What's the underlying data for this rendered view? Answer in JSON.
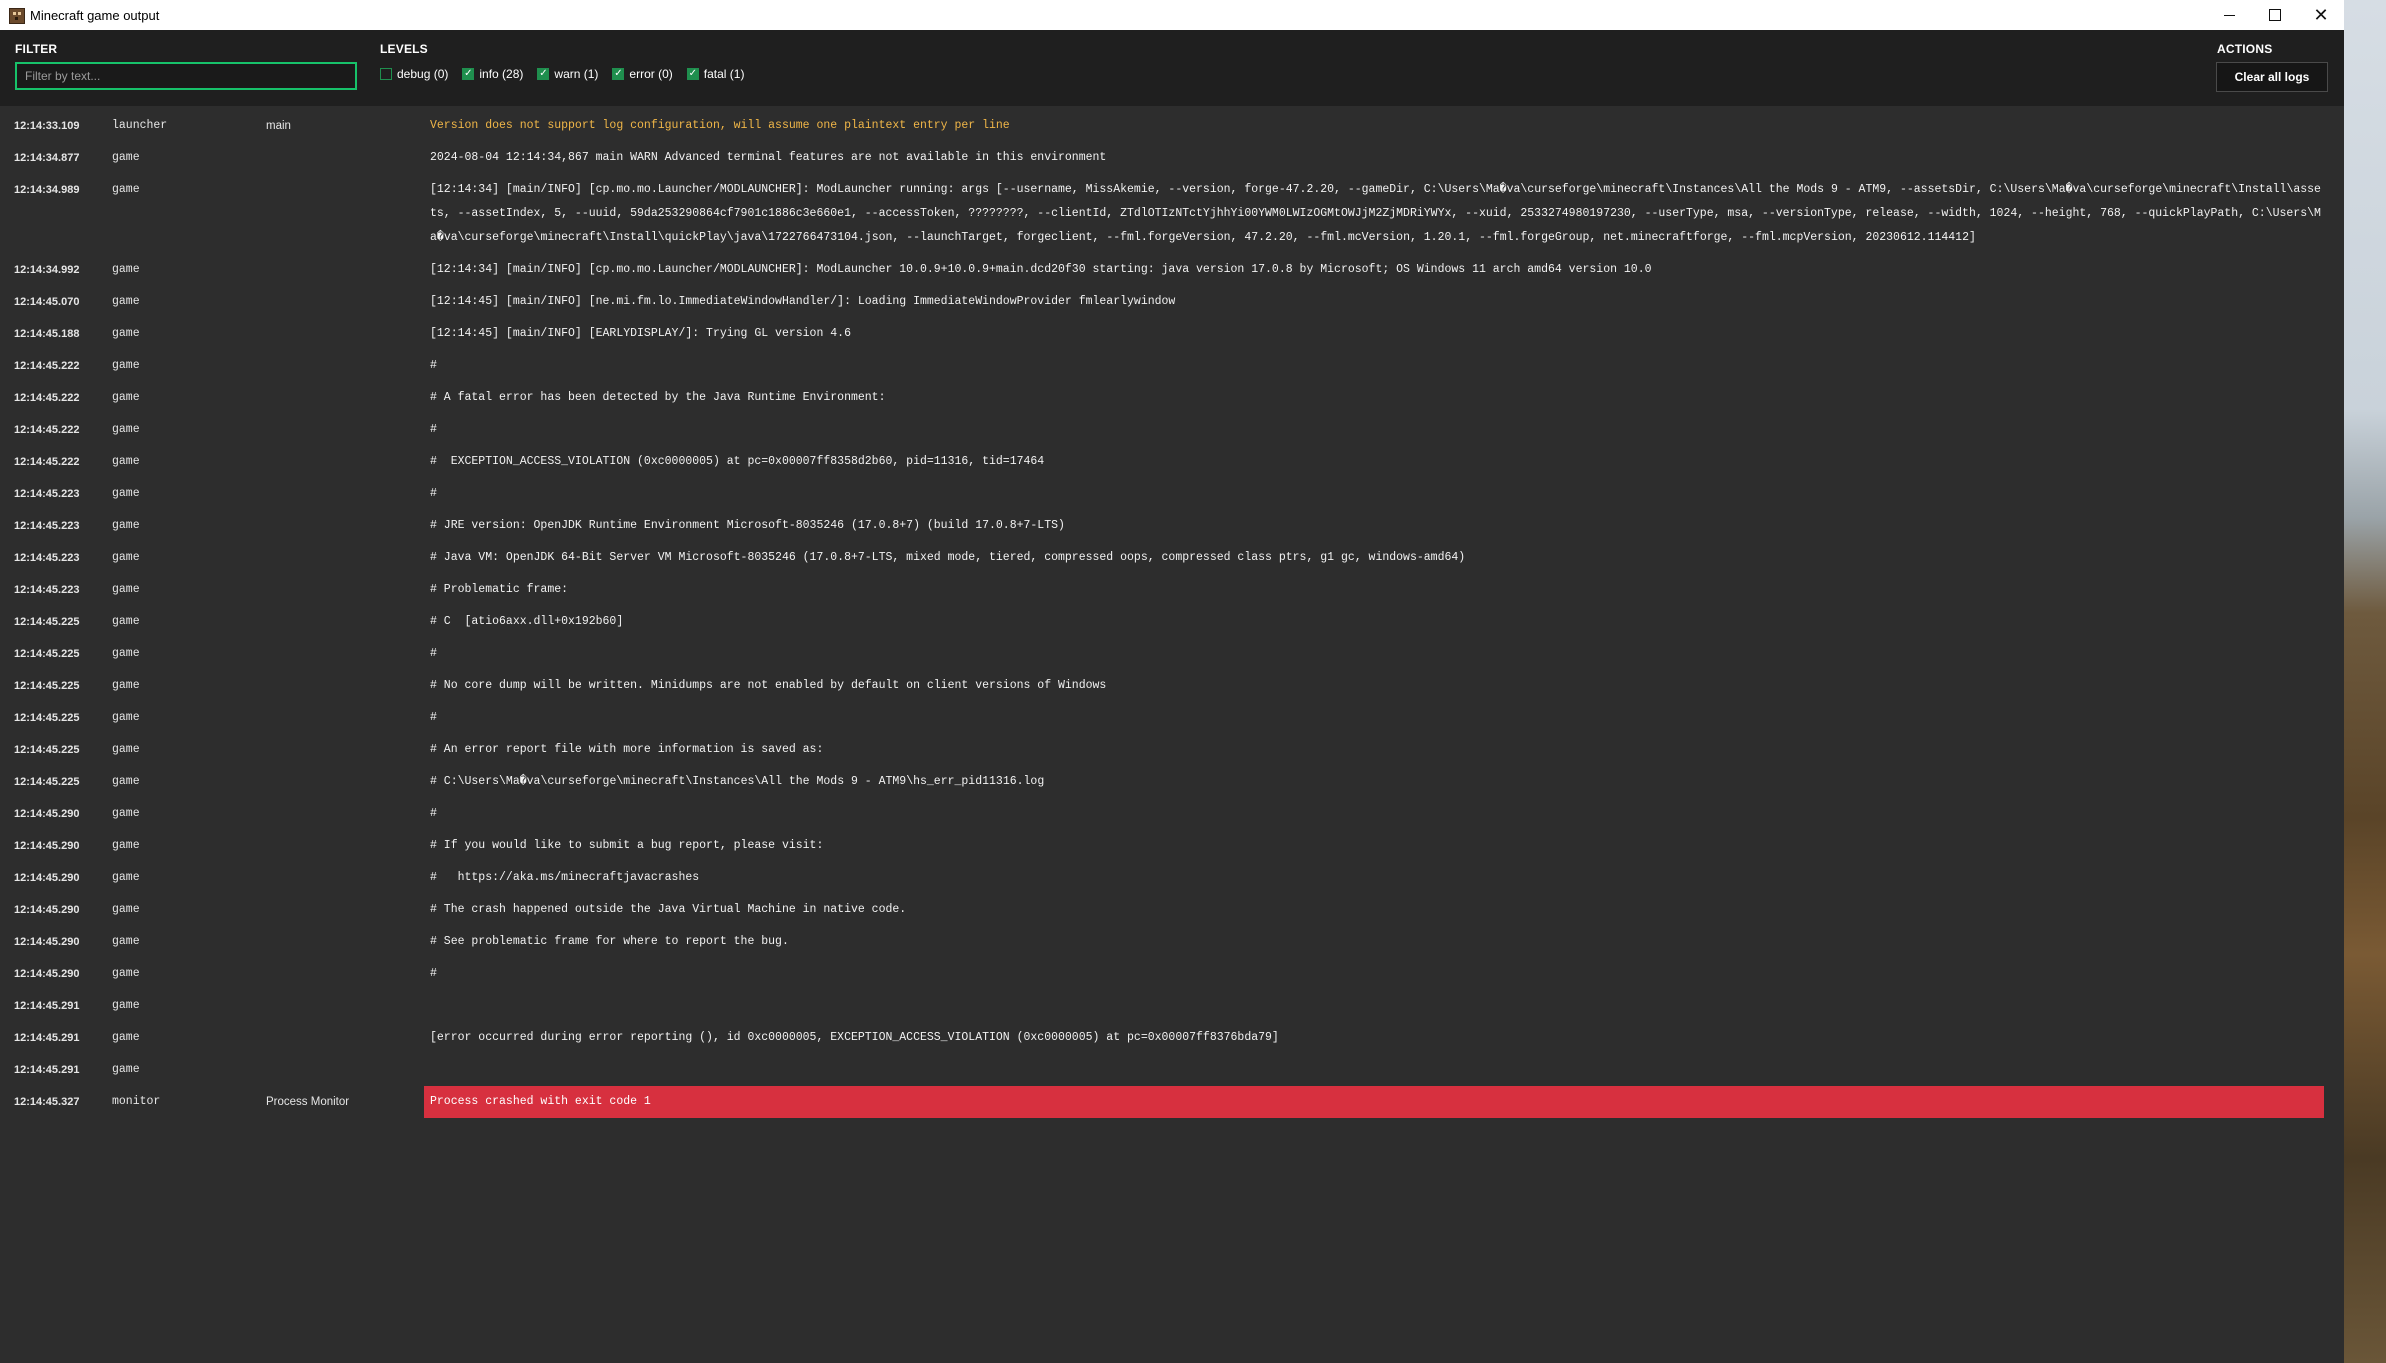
{
  "window": {
    "title": "Minecraft game output"
  },
  "toolbar": {
    "filter_label": "FILTER",
    "filter_placeholder": "Filter by text...",
    "filter_value": "",
    "levels_label": "LEVELS",
    "levels": [
      {
        "key": "debug",
        "label": "debug (0)",
        "checked": false
      },
      {
        "key": "info",
        "label": "info (28)",
        "checked": true
      },
      {
        "key": "warn",
        "label": "warn (1)",
        "checked": true
      },
      {
        "key": "error",
        "label": "error (0)",
        "checked": true
      },
      {
        "key": "fatal",
        "label": "fatal (1)",
        "checked": true
      }
    ],
    "actions_label": "ACTIONS",
    "clear_label": "Clear all logs"
  },
  "colors": {
    "accent": "#17c26a",
    "warn": "#f0b648",
    "fatal": "#d7303f"
  },
  "logs": [
    {
      "time": "12:14:33.109",
      "source": "launcher",
      "thread": "main",
      "level": "warn",
      "message": "Version does not support log configuration, will assume one plaintext entry per line"
    },
    {
      "time": "12:14:34.877",
      "source": "game",
      "thread": "",
      "level": "info",
      "message": "2024-08-04 12:14:34,867 main WARN Advanced terminal features are not available in this environment"
    },
    {
      "time": "12:14:34.989",
      "source": "game",
      "thread": "",
      "level": "info",
      "lines": 3,
      "message": "[12:14:34] [main/INFO] [cp.mo.mo.Launcher/MODLAUNCHER]: ModLauncher running: args [--username, MissAkemie, --version, forge-47.2.20, --gameDir, C:\\Users\\Ma�va\\curseforge\\minecraft\\Instances\\All the Mods 9 - ATM9, --assetsDir, C:\\Users\\Ma�va\\curseforge\\minecraft\\Install\\assets, --assetIndex, 5, --uuid, 59da253290864cf7901c1886c3e660e1, --accessToken, ????????, --clientId, ZTdlOTIzNTctYjhhYi00YWM0LWIzOGMtOWJjM2ZjMDRiYWYx, --xuid, 2533274980197230, --userType, msa, --versionType, release, --width, 1024, --height, 768, --quickPlayPath, C:\\Users\\Ma�va\\curseforge\\minecraft\\Install\\quickPlay\\java\\1722766473104.json, --launchTarget, forgeclient, --fml.forgeVersion, 47.2.20, --fml.mcVersion, 1.20.1, --fml.forgeGroup, net.minecraftforge, --fml.mcpVersion, 20230612.114412]"
    },
    {
      "time": "12:14:34.992",
      "source": "game",
      "thread": "",
      "level": "info",
      "message": "[12:14:34] [main/INFO] [cp.mo.mo.Launcher/MODLAUNCHER]: ModLauncher 10.0.9+10.0.9+main.dcd20f30 starting: java version 17.0.8 by Microsoft; OS Windows 11 arch amd64 version 10.0"
    },
    {
      "time": "12:14:45.070",
      "source": "game",
      "thread": "",
      "level": "info",
      "message": "[12:14:45] [main/INFO] [ne.mi.fm.lo.ImmediateWindowHandler/]: Loading ImmediateWindowProvider fmlearlywindow"
    },
    {
      "time": "12:14:45.188",
      "source": "game",
      "thread": "",
      "level": "info",
      "message": "[12:14:45] [main/INFO] [EARLYDISPLAY/]: Trying GL version 4.6"
    },
    {
      "time": "12:14:45.222",
      "source": "game",
      "thread": "",
      "level": "info",
      "message": "#"
    },
    {
      "time": "12:14:45.222",
      "source": "game",
      "thread": "",
      "level": "info",
      "message": "# A fatal error has been detected by the Java Runtime Environment:"
    },
    {
      "time": "12:14:45.222",
      "source": "game",
      "thread": "",
      "level": "info",
      "message": "#"
    },
    {
      "time": "12:14:45.222",
      "source": "game",
      "thread": "",
      "level": "info",
      "message": "#  EXCEPTION_ACCESS_VIOLATION (0xc0000005) at pc=0x00007ff8358d2b60, pid=11316, tid=17464"
    },
    {
      "time": "12:14:45.223",
      "source": "game",
      "thread": "",
      "level": "info",
      "message": "#"
    },
    {
      "time": "12:14:45.223",
      "source": "game",
      "thread": "",
      "level": "info",
      "message": "# JRE version: OpenJDK Runtime Environment Microsoft-8035246 (17.0.8+7) (build 17.0.8+7-LTS)"
    },
    {
      "time": "12:14:45.223",
      "source": "game",
      "thread": "",
      "level": "info",
      "message": "# Java VM: OpenJDK 64-Bit Server VM Microsoft-8035246 (17.0.8+7-LTS, mixed mode, tiered, compressed oops, compressed class ptrs, g1 gc, windows-amd64)"
    },
    {
      "time": "12:14:45.223",
      "source": "game",
      "thread": "",
      "level": "info",
      "message": "# Problematic frame:"
    },
    {
      "time": "12:14:45.225",
      "source": "game",
      "thread": "",
      "level": "info",
      "message": "# C  [atio6axx.dll+0x192b60]"
    },
    {
      "time": "12:14:45.225",
      "source": "game",
      "thread": "",
      "level": "info",
      "message": "#"
    },
    {
      "time": "12:14:45.225",
      "source": "game",
      "thread": "",
      "level": "info",
      "message": "# No core dump will be written. Minidumps are not enabled by default on client versions of Windows"
    },
    {
      "time": "12:14:45.225",
      "source": "game",
      "thread": "",
      "level": "info",
      "message": "#"
    },
    {
      "time": "12:14:45.225",
      "source": "game",
      "thread": "",
      "level": "info",
      "message": "# An error report file with more information is saved as:"
    },
    {
      "time": "12:14:45.225",
      "source": "game",
      "thread": "",
      "level": "info",
      "message": "# C:\\Users\\Ma�va\\curseforge\\minecraft\\Instances\\All the Mods 9 - ATM9\\hs_err_pid11316.log"
    },
    {
      "time": "12:14:45.290",
      "source": "game",
      "thread": "",
      "level": "info",
      "message": "#"
    },
    {
      "time": "12:14:45.290",
      "source": "game",
      "thread": "",
      "level": "info",
      "message": "# If you would like to submit a bug report, please visit:"
    },
    {
      "time": "12:14:45.290",
      "source": "game",
      "thread": "",
      "level": "info",
      "message": "#   https://aka.ms/minecraftjavacrashes"
    },
    {
      "time": "12:14:45.290",
      "source": "game",
      "thread": "",
      "level": "info",
      "message": "# The crash happened outside the Java Virtual Machine in native code."
    },
    {
      "time": "12:14:45.290",
      "source": "game",
      "thread": "",
      "level": "info",
      "message": "# See problematic frame for where to report the bug."
    },
    {
      "time": "12:14:45.290",
      "source": "game",
      "thread": "",
      "level": "info",
      "message": "#"
    },
    {
      "time": "12:14:45.291",
      "source": "game",
      "thread": "",
      "level": "info",
      "message": ""
    },
    {
      "time": "12:14:45.291",
      "source": "game",
      "thread": "",
      "level": "info",
      "message": "[error occurred during error reporting (), id 0xc0000005, EXCEPTION_ACCESS_VIOLATION (0xc0000005) at pc=0x00007ff8376bda79]"
    },
    {
      "time": "12:14:45.291",
      "source": "game",
      "thread": "",
      "level": "info",
      "message": ""
    },
    {
      "time": "12:14:45.327",
      "source": "monitor",
      "thread": "Process Monitor",
      "level": "fatal",
      "message": "Process crashed with exit code 1"
    }
  ]
}
